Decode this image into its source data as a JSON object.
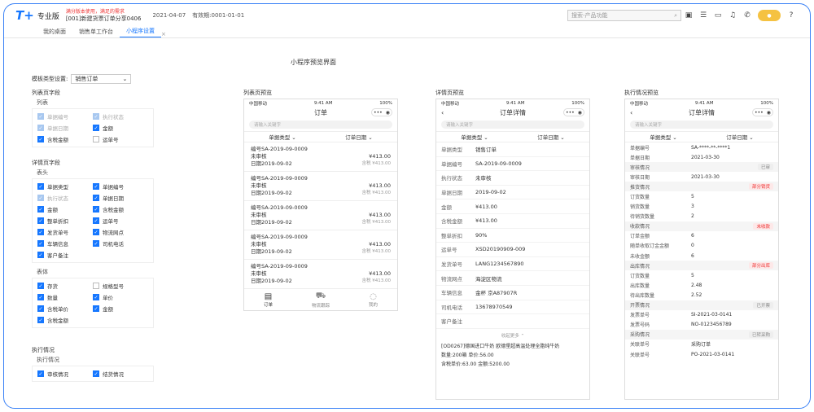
{
  "header": {
    "logo": "T+",
    "logo_sub": "专业版",
    "notice_top": "满分版本使用，满足的需求",
    "notice_bottom": "[001]新建货票订单分享0406",
    "date": "2021-04-07",
    "validity": "有效期:0001-01-01",
    "search_placeholder": "搜索-产品功能"
  },
  "tabs": [
    {
      "label": "我的桌面",
      "active": false
    },
    {
      "label": "销售单工作台",
      "active": false
    },
    {
      "label": "小程序设置",
      "active": true
    }
  ],
  "page_title": "小程序预览界面",
  "template": {
    "label": "模板类型设置:",
    "value": "销售订单"
  },
  "list_fields": {
    "title": "列表页字段",
    "sub": "列表",
    "items": [
      {
        "label": "单据编号",
        "state": "dis"
      },
      {
        "label": "执行状态",
        "state": "dis"
      },
      {
        "label": "单据日期",
        "state": "dis"
      },
      {
        "label": "金额",
        "state": "on"
      },
      {
        "label": "含税金额",
        "state": "on"
      },
      {
        "label": "运单号",
        "state": "off"
      }
    ]
  },
  "detail_fields": {
    "title": "详情页字段",
    "head_sub": "表头",
    "head_items": [
      {
        "label": "单据类型",
        "state": "on"
      },
      {
        "label": "单据编号",
        "state": "on"
      },
      {
        "label": "执行状态",
        "state": "dis"
      },
      {
        "label": "单据日期",
        "state": "on"
      },
      {
        "label": "金额",
        "state": "on"
      },
      {
        "label": "含税金额",
        "state": "on"
      },
      {
        "label": "整单折扣",
        "state": "on"
      },
      {
        "label": "运单号",
        "state": "on"
      },
      {
        "label": "发货单号",
        "state": "on"
      },
      {
        "label": "物流网点",
        "state": "on"
      },
      {
        "label": "车辆信息",
        "state": "on"
      },
      {
        "label": "司机电话",
        "state": "on"
      },
      {
        "label": "客户备注",
        "state": "on"
      }
    ],
    "body_sub": "表体",
    "body_items": [
      {
        "label": "存货",
        "state": "on"
      },
      {
        "label": "规格型号",
        "state": "off"
      },
      {
        "label": "数量",
        "state": "on"
      },
      {
        "label": "单价",
        "state": "on"
      },
      {
        "label": "含税单价",
        "state": "on"
      },
      {
        "label": "金额",
        "state": "on"
      },
      {
        "label": "含税金额",
        "state": "on"
      }
    ]
  },
  "exec_fields": {
    "title": "执行情况",
    "sub": "执行情况",
    "items": [
      {
        "label": "审核情况",
        "state": "on"
      },
      {
        "label": "结货情况",
        "state": "on"
      }
    ]
  },
  "phone_common": {
    "carrier": "中国移动",
    "time": "9:41 AM",
    "battery": "100%",
    "search": "请输入关键字",
    "filter1": "单据类型",
    "filter2": "订单日期"
  },
  "list_preview": {
    "label": "列表页预览",
    "title": "订单",
    "orders": [
      {
        "no": "编号SA-2019-09-0009",
        "status": "未审核",
        "amount": "¥413.00",
        "date": "日期2019-09-02",
        "tax": "含税 ¥413.00"
      },
      {
        "no": "编号SA-2019-09-0009",
        "status": "未审核",
        "amount": "¥413.00",
        "date": "日期2019-09-02",
        "tax": "含税 ¥413.00"
      },
      {
        "no": "编号SA-2019-09-0009",
        "status": "未审核",
        "amount": "¥413.00",
        "date": "日期2019-09-02",
        "tax": "含税 ¥413.00"
      },
      {
        "no": "编号SA-2019-09-0009",
        "status": "未审核",
        "amount": "¥413.00",
        "date": "日期2019-09-02",
        "tax": "含税 ¥413.00"
      },
      {
        "no": "编号SA-2019-09-0009",
        "status": "未审核",
        "amount": "¥413.00",
        "date": "日期2019-09-02",
        "tax": "含税 ¥413.00"
      }
    ],
    "nav": [
      {
        "label": "订单",
        "active": true
      },
      {
        "label": "物流跟踪",
        "active": false
      },
      {
        "label": "我的",
        "active": false
      }
    ]
  },
  "detail_preview": {
    "label": "详情页预览",
    "title": "订单详情",
    "rows": [
      {
        "k": "单据类型",
        "v": "销售订单"
      },
      {
        "k": "单据编号",
        "v": "SA-2019-09-0009"
      },
      {
        "k": "执行状态",
        "v": "未审核"
      },
      {
        "k": "单据日期",
        "v": "2019-09-02"
      },
      {
        "k": "金额",
        "v": "¥413.00"
      },
      {
        "k": "含税金额",
        "v": "¥413.00"
      },
      {
        "k": "整单折扣",
        "v": "90%"
      },
      {
        "k": "运单号",
        "v": "XSD20190909-009"
      },
      {
        "k": "发货单号",
        "v": "LANG1234567890"
      },
      {
        "k": "物流网点",
        "v": "海淀区物流"
      },
      {
        "k": "车辆信息",
        "v": "金杯 京A87907R"
      },
      {
        "k": "司机电话",
        "v": "13678970549"
      },
      {
        "k": "客户备注",
        "v": ""
      }
    ],
    "more": "收起更多",
    "item_title": "[OD0267]德国进口牛奶 欧德堡超高温处理全脂纯牛奶",
    "item_qty": "数量:200箱",
    "item_price": "单价:56.00",
    "item_tax_price": "含税单价:63.00",
    "item_amount": "金额:5200.00"
  },
  "exec_preview": {
    "label": "执行情况预览",
    "title": "订单详情",
    "rows": [
      {
        "type": "row",
        "k": "单据编号",
        "v": "SA-****-**-****1"
      },
      {
        "type": "row",
        "k": "单据日期",
        "v": "2021-03-30"
      },
      {
        "type": "sec",
        "k": "审核情况",
        "badge": "已审",
        "badge_color": "gray"
      },
      {
        "type": "row",
        "k": "审核日期",
        "v": "2021-03-30"
      },
      {
        "type": "sec",
        "k": "推货情况",
        "badge": "部分销货",
        "badge_color": "red"
      },
      {
        "type": "row",
        "k": "订货数量",
        "v": "5"
      },
      {
        "type": "row",
        "k": "销货数量",
        "v": "3"
      },
      {
        "type": "row",
        "k": "待销货数量",
        "v": "2"
      },
      {
        "type": "sec",
        "k": "收款情况",
        "badge": "未收款",
        "badge_color": "red"
      },
      {
        "type": "row",
        "k": "订单金额",
        "v": "6"
      },
      {
        "type": "row",
        "k": "随单收取订金金额",
        "v": "0"
      },
      {
        "type": "row",
        "k": "未收金额",
        "v": "6"
      },
      {
        "type": "sec",
        "k": "出库情况",
        "badge": "部分出库",
        "badge_color": "red"
      },
      {
        "type": "row",
        "k": "订货数量",
        "v": "5"
      },
      {
        "type": "row",
        "k": "出库数量",
        "v": "2.48"
      },
      {
        "type": "row",
        "k": "待出库数量",
        "v": "2.52"
      },
      {
        "type": "sec",
        "k": "开票情况",
        "badge": "已开票",
        "badge_color": "gray"
      },
      {
        "type": "row",
        "k": "发票单号",
        "v": "SI-2021-03-0141"
      },
      {
        "type": "row",
        "k": "发票号码",
        "v": "NO-0123456789"
      },
      {
        "type": "sec",
        "k": "采购情况",
        "badge": "已转采购",
        "badge_color": "gray"
      },
      {
        "type": "row",
        "k": "关联单号",
        "v": "采购订单"
      },
      {
        "type": "row",
        "k": "关联单号",
        "v": "PO-2021-03-0141"
      }
    ]
  }
}
